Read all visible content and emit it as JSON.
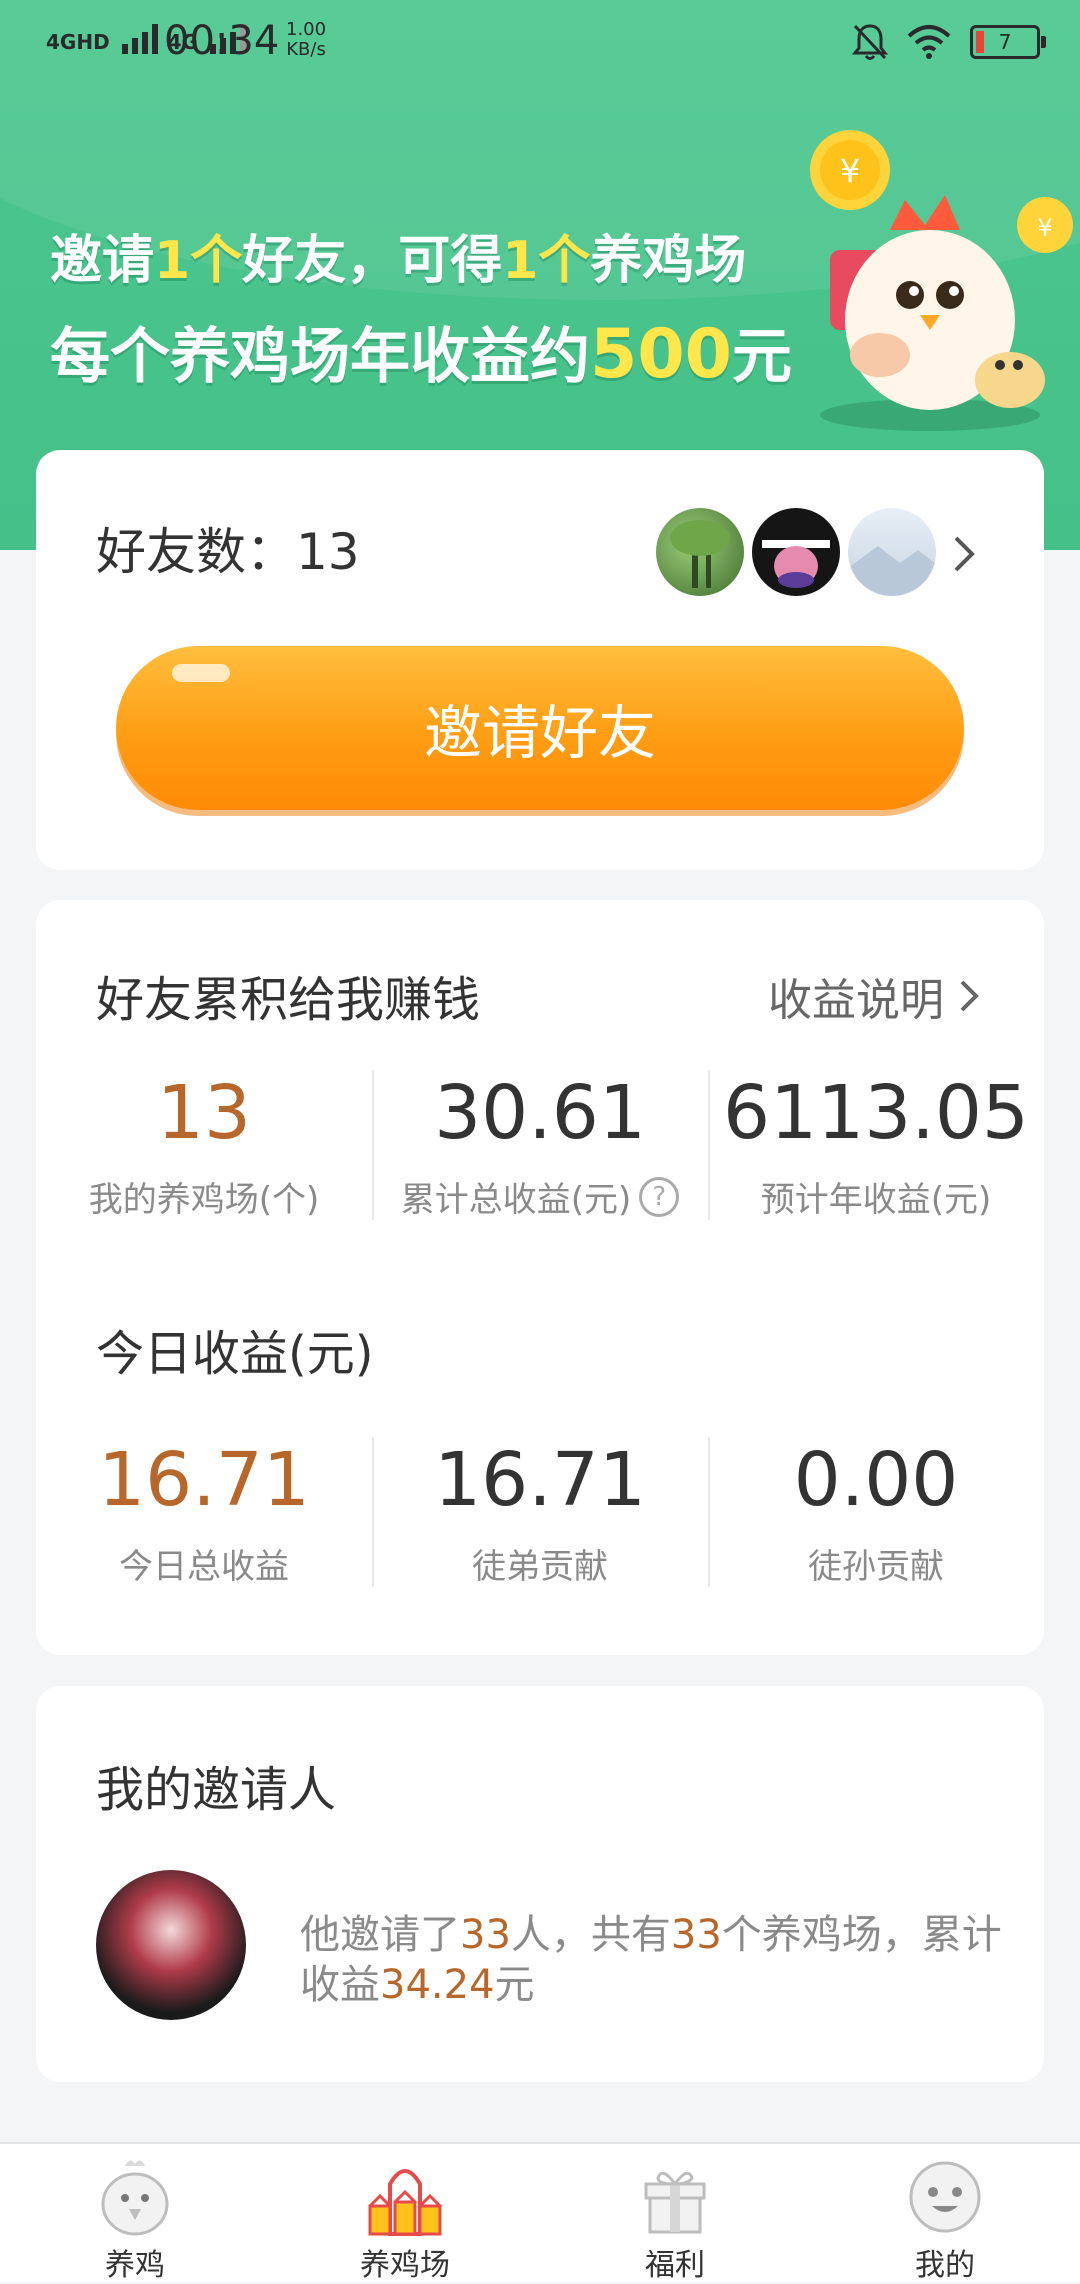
{
  "status_bar": {
    "network1": "4GHD",
    "network2": "4G",
    "time": "00:34",
    "speed_value": "1.00",
    "speed_unit": "KB/s",
    "battery": "7"
  },
  "banner": {
    "line1_a": "邀请",
    "line1_b": "1个",
    "line1_c": "好友，可得",
    "line1_d": "1个",
    "line1_e": "养鸡场",
    "line2_a": "每个养鸡场年收益约",
    "line2_b": "500",
    "line2_c": "元"
  },
  "friends": {
    "label": "好友数：",
    "count": "13",
    "invite_button": "邀请好友"
  },
  "earnings": {
    "title": "好友累积给我赚钱",
    "link": "收益说明",
    "stats": [
      {
        "value": "13",
        "label": "我的养鸡场(个)"
      },
      {
        "value": "30.61",
        "label": "累计总收益(元)"
      },
      {
        "value": "6113.05",
        "label": "预计年收益(元)"
      }
    ],
    "today_title": "今日收益(元)",
    "today": [
      {
        "value": "16.71",
        "label": "今日总收益"
      },
      {
        "value": "16.71",
        "label": "徒弟贡献"
      },
      {
        "value": "0.00",
        "label": "徒孙贡献"
      }
    ]
  },
  "inviter": {
    "title": "我的邀请人",
    "t1": "他邀请了",
    "n1": "33",
    "t2": "人，共有",
    "n2": "33",
    "t3": "个养鸡场，累计收益",
    "n3": "34.24",
    "t4": "元"
  },
  "nav": [
    {
      "label": "养鸡"
    },
    {
      "label": "养鸡场"
    },
    {
      "label": "福利"
    },
    {
      "label": "我的"
    }
  ],
  "colors": {
    "header_green": "#4cc78f",
    "accent_orange": "#ff9d14",
    "value_brown": "#b8672a"
  }
}
